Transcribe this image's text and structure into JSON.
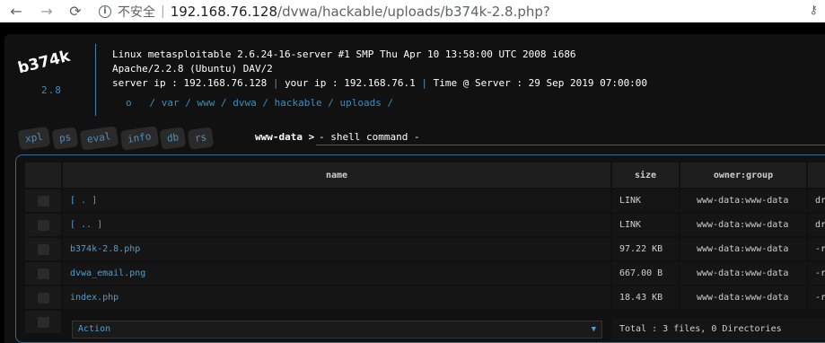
{
  "browser": {
    "back_icon": "←",
    "forward_icon": "→",
    "reload_icon": "⟳",
    "info_icon": "i",
    "insecure_label": "不安全",
    "separator": "|",
    "url_host": "192.168.76.128",
    "url_path": "/dvwa/hackable/uploads/b374k-2.8.php?",
    "key_icon": "⚷"
  },
  "shell": {
    "logo": "b374k",
    "version": "2.8",
    "sysinfo": {
      "uname": "Linux metasploitable 2.6.24-16-server #1 SMP Thu Apr 10 13:58:00 UTC 2008 i686",
      "server_software": "Apache/2.2.8 (Ubuntu) DAV/2",
      "server_ip_label": "server ip : 192.168.76.128",
      "your_ip_label": "your ip : 192.168.76.1",
      "time_label": "Time @ Server : 29 Sep 2019 07:00:00",
      "pipe": "|"
    },
    "path": {
      "root": "o",
      "parts": [
        "/",
        "var",
        "/",
        "www",
        "/",
        "dvwa",
        "/",
        "hackable",
        "/",
        "uploads",
        "/"
      ]
    },
    "tabs": [
      "xpl",
      "ps",
      "eval",
      "info",
      "db",
      "rs"
    ],
    "prompt": "www-data >",
    "command_placeholder": "- shell command -"
  },
  "table": {
    "headers": {
      "name": "name",
      "size": "size",
      "owner": "owner:group",
      "perms": ""
    },
    "rows": [
      {
        "name": "[ . ]",
        "size": "LINK",
        "owner": "www-data:www-data",
        "perms": "dr"
      },
      {
        "name": "[ .. ]",
        "size": "LINK",
        "owner": "www-data:www-data",
        "perms": "dr"
      },
      {
        "name": "b374k-2.8.php",
        "size": "97.22 KB",
        "owner": "www-data:www-data",
        "perms": "-r"
      },
      {
        "name": "dvwa_email.png",
        "size": "667.00 B",
        "owner": "www-data:www-data",
        "perms": "-r"
      },
      {
        "name": "index.php",
        "size": "18.43 KB",
        "owner": "www-data:www-data",
        "perms": "-r"
      }
    ],
    "action_label": "Action",
    "action_arrow": "▼",
    "total": "Total : 3 files, 0 Directories"
  }
}
